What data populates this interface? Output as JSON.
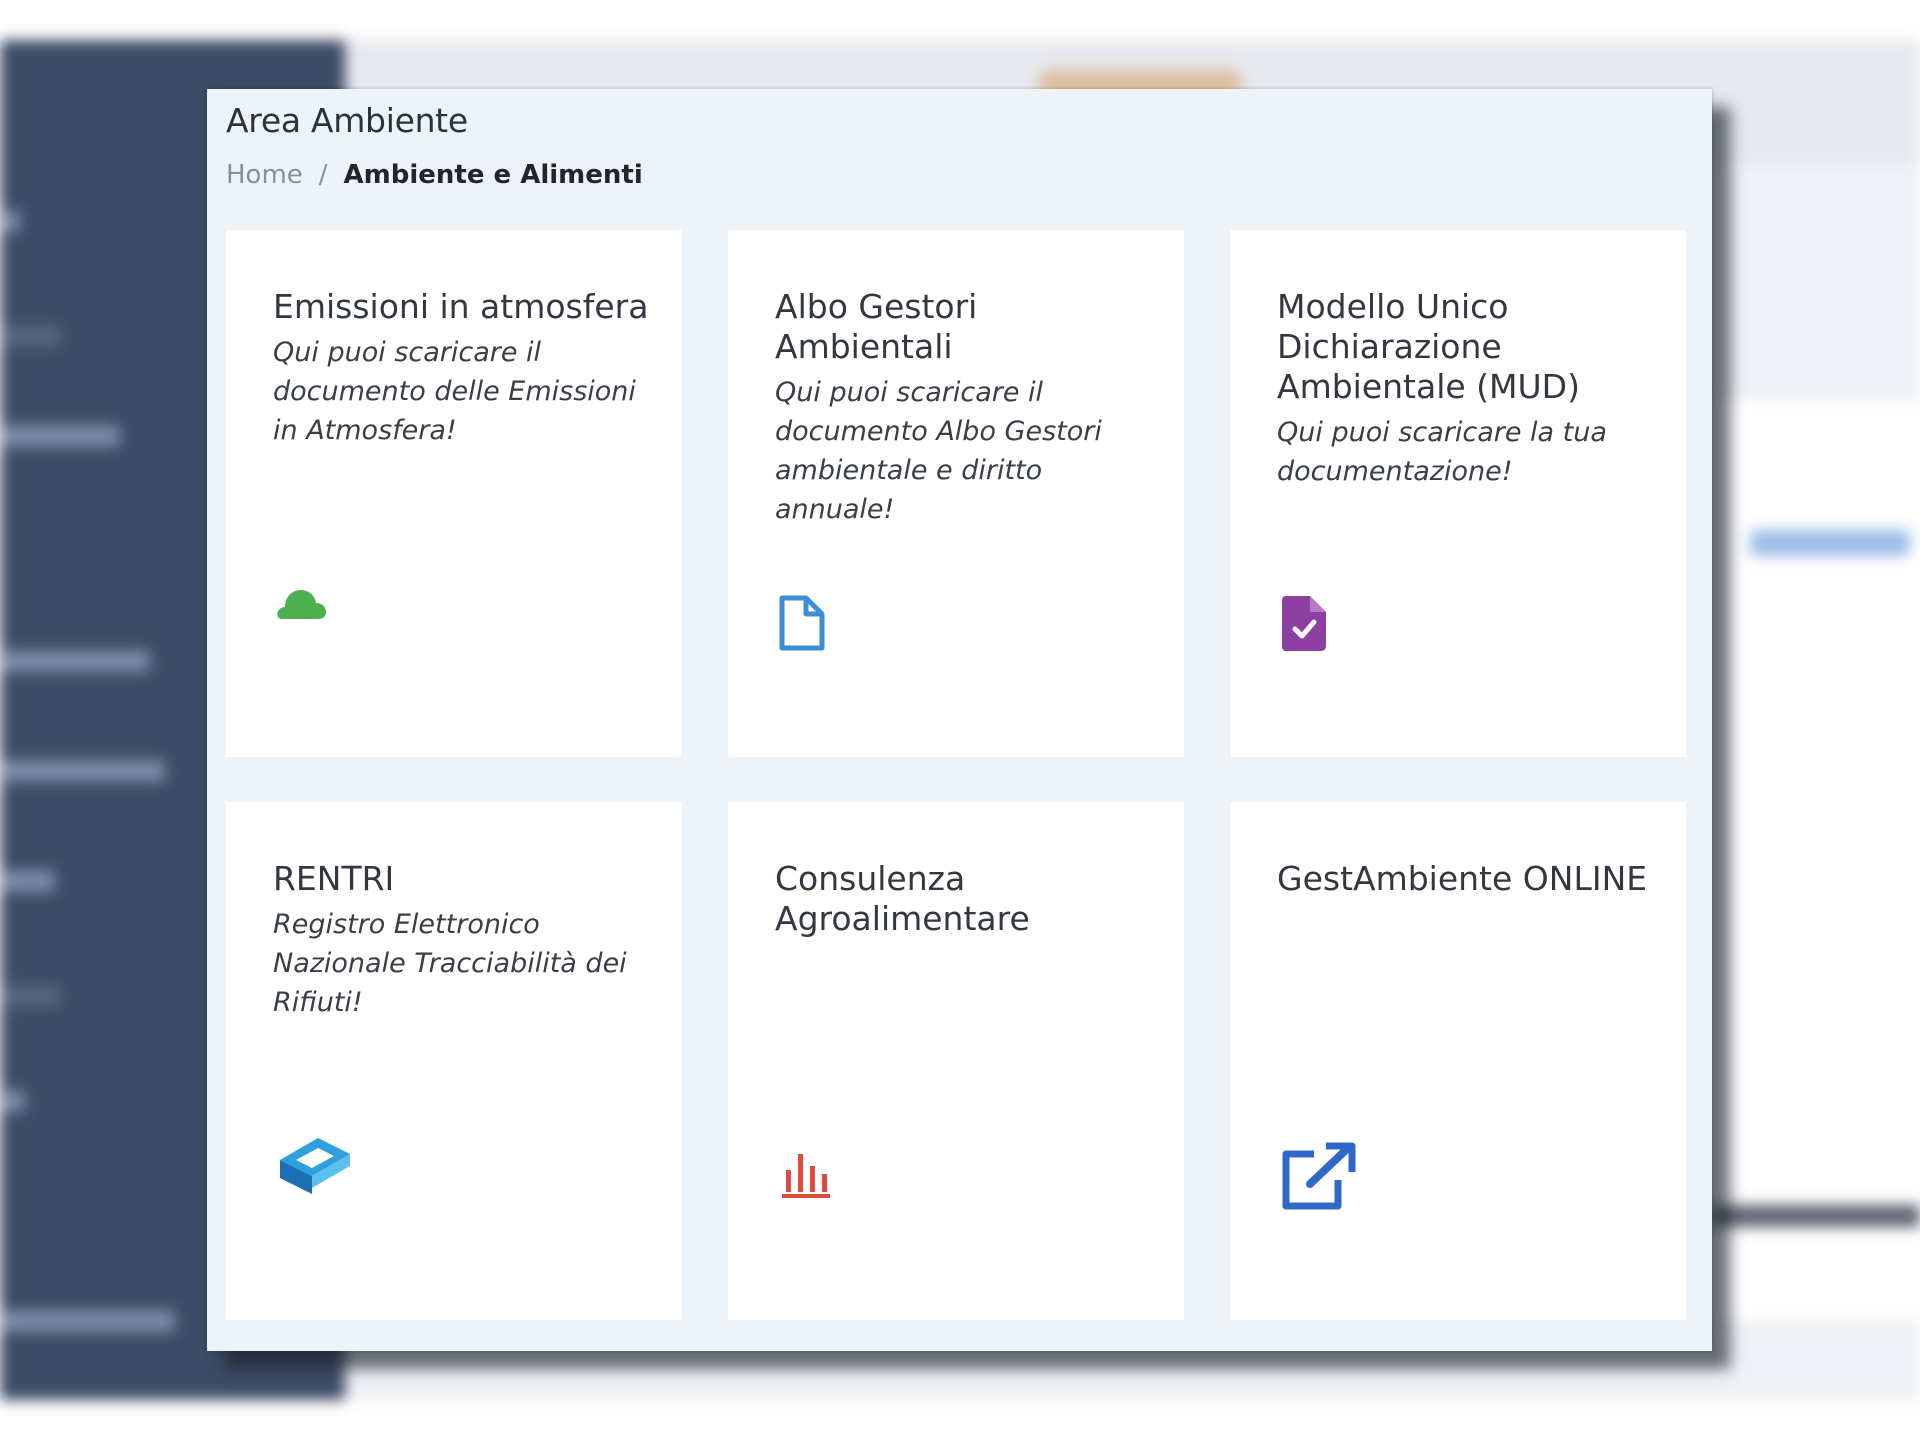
{
  "modal": {
    "title": "Area Ambiente",
    "breadcrumb": {
      "home": "Home",
      "separator": "/",
      "current": "Ambiente e Alimenti"
    }
  },
  "cards": [
    {
      "title": "Emissioni in atmosfera",
      "description": "Qui puoi scaricare il documento delle Emissioni in Atmosfera!",
      "icon": "cloud-icon",
      "icon_color": "#4caf50"
    },
    {
      "title": "Albo Gestori Ambientali",
      "description": "Qui puoi scaricare il documento Albo Gestori ambientale e diritto annuale!",
      "icon": "file-icon",
      "icon_color": "#3b8ed6"
    },
    {
      "title": "Modello Unico Dichiarazione Ambientale (MUD)",
      "description": "Qui puoi scaricare la tua documentazione!",
      "icon": "file-check-icon",
      "icon_color": "#8e3fa3"
    },
    {
      "title": "RENTRI",
      "description": "Registro Elettronico Nazionale Tracciabilità dei Rifiuti!",
      "icon": "rentri-logo-icon",
      "icon_color": "#2f9fde"
    },
    {
      "title": "Consulenza Agroalimentare",
      "description": "",
      "icon": "bar-chart-icon",
      "icon_color": "#e04a3c"
    },
    {
      "title": "GestAmbiente ONLINE",
      "description": "",
      "icon": "external-link-icon",
      "icon_color": "#2f68c8"
    }
  ],
  "colors": {
    "sidebar": "#3d4b66",
    "modal_background": "#eef3f7",
    "card_background": "#ffffff"
  }
}
